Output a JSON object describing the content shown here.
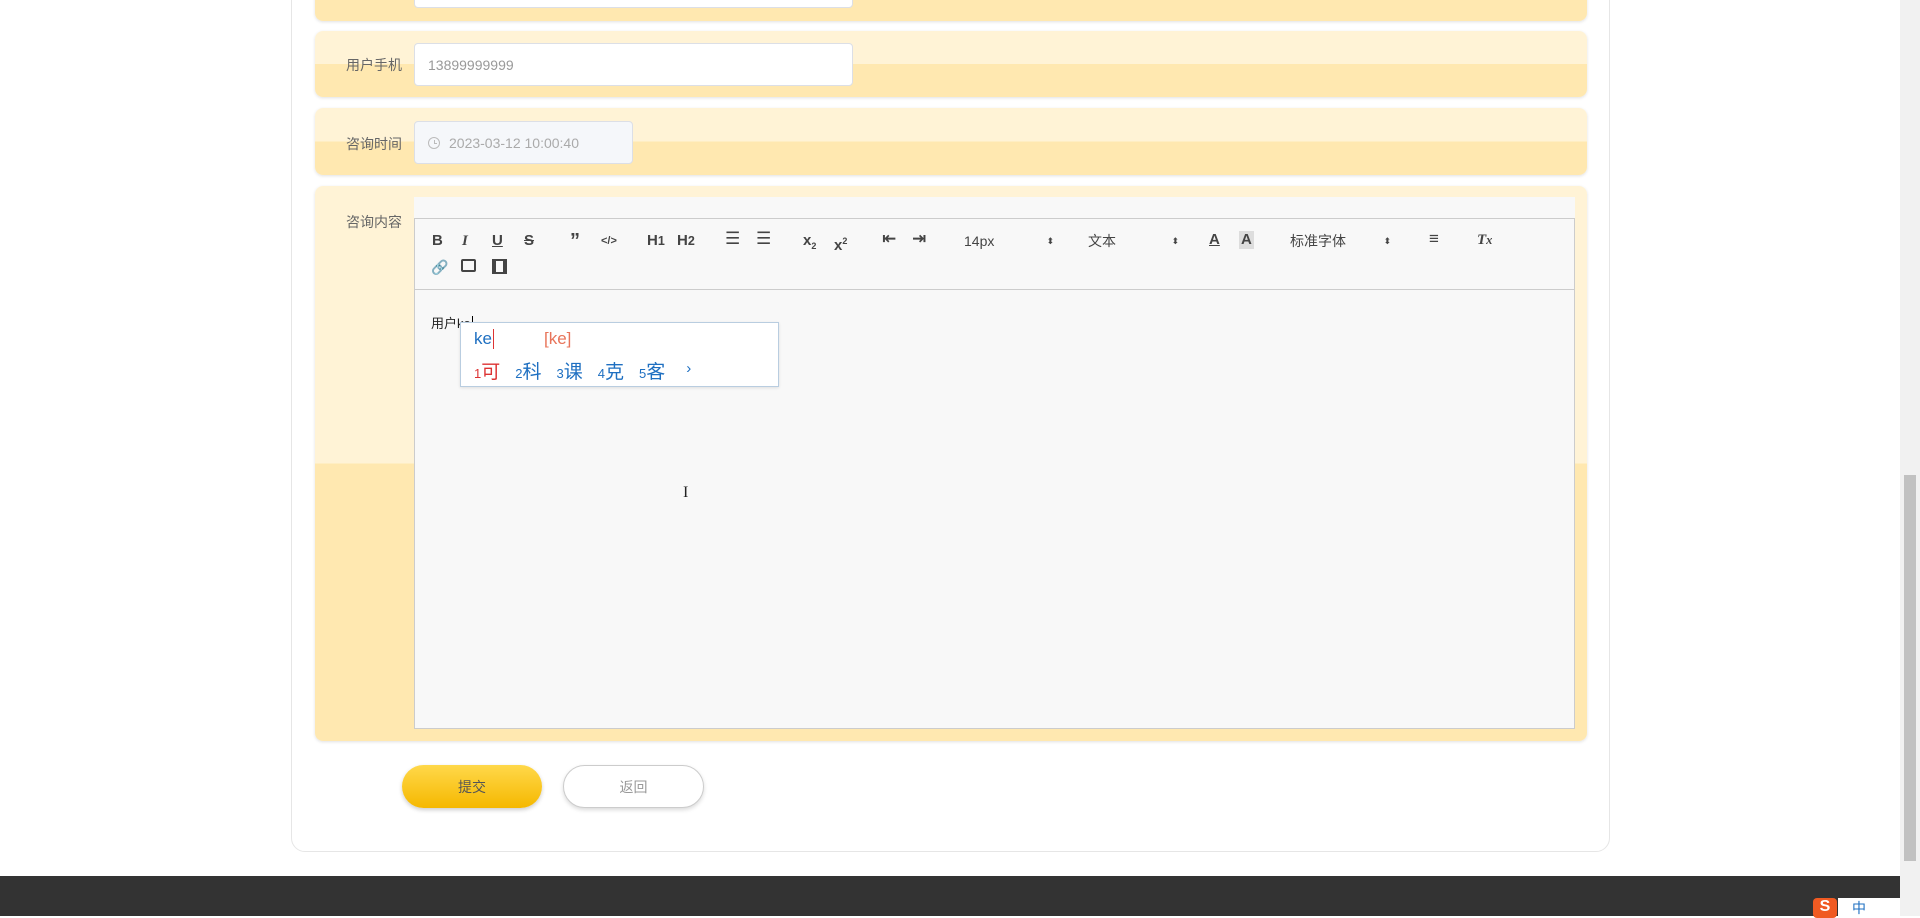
{
  "form": {
    "phone": {
      "label": "用户手机",
      "value": "13899999999"
    },
    "time": {
      "label": "咨询时间",
      "value": "2023-03-12 10:00:40",
      "icon": "clock-icon"
    },
    "content": {
      "label": "咨询内容",
      "text": "用户ke"
    }
  },
  "toolbar": {
    "font_size": "14px",
    "header": "文本",
    "font_family": "标准字体"
  },
  "ime": {
    "input": "ke",
    "pinyin": "[ke]",
    "candidates": [
      {
        "n": "1",
        "c": "可"
      },
      {
        "n": "2",
        "c": "科"
      },
      {
        "n": "3",
        "c": "课"
      },
      {
        "n": "4",
        "c": "克"
      },
      {
        "n": "5",
        "c": "客"
      }
    ],
    "next": "›",
    "tray": "中"
  },
  "buttons": {
    "submit": "提交",
    "back": "返回"
  },
  "colors": {
    "accent": "#f7c21c",
    "row_light": "#fff3d6",
    "row_dark": "#ffe8b0",
    "footer": "#333333"
  }
}
